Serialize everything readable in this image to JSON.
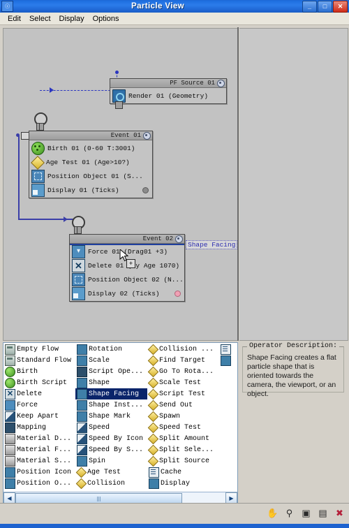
{
  "window": {
    "title": "Particle View",
    "system_icon": "particle-view-icon",
    "buttons": [
      {
        "name": "minimize-button",
        "glyph": "_"
      },
      {
        "name": "maximize-button",
        "glyph": "□"
      },
      {
        "name": "close-button",
        "glyph": "✕"
      }
    ]
  },
  "menubar": {
    "items": [
      {
        "label": "Edit"
      },
      {
        "label": "Select"
      },
      {
        "label": "Display"
      },
      {
        "label": "Options"
      }
    ]
  },
  "graph": {
    "nodes": [
      {
        "title": "PF Source 01",
        "rows": [
          {
            "label": "Render 01 (Geometry)",
            "icon": "render-icon",
            "dot": ""
          }
        ]
      },
      {
        "title": "Event 01",
        "rows": [
          {
            "label": "Birth 01  (0-60 T:3001)",
            "icon": "birth-icon",
            "dot": ""
          },
          {
            "label": "Age Test 01  (Age>10?)",
            "icon": "test-icon",
            "dot": ""
          },
          {
            "label": "Position Object 01  (S...",
            "icon": "position-object-icon",
            "dot": ""
          },
          {
            "label": "Display 01 (Ticks)",
            "icon": "display-icon",
            "dot": "gray"
          }
        ]
      },
      {
        "title": "Event 02",
        "rows": [
          {
            "label": "Force 01 (Drag01 +3)",
            "icon": "force-icon",
            "dot": ""
          },
          {
            "label": "Delete 01 (By Age 1070)",
            "icon": "delete-icon",
            "dot": ""
          },
          {
            "label": "Position Object 02  (N...",
            "icon": "position-object-icon",
            "dot": ""
          },
          {
            "label": "Display 02 (Ticks)",
            "icon": "display-icon",
            "dot": "pink"
          }
        ]
      }
    ],
    "drag_ghost_label": "Shape Facing",
    "cursor_badge": "+"
  },
  "depot": {
    "columns": [
      {
        "items": [
          {
            "label": "Empty Flow",
            "icon": "empty-flow-icon",
            "style": "flow",
            "selected": false
          },
          {
            "label": "Standard Flow",
            "icon": "standard-flow-icon",
            "style": "flow",
            "selected": false
          },
          {
            "label": "Birth",
            "icon": "birth-icon",
            "style": "birth",
            "selected": false
          },
          {
            "label": "Birth Script",
            "icon": "birth-script-icon",
            "style": "birth",
            "selected": false
          },
          {
            "label": "Delete",
            "icon": "delete-icon",
            "style": "del",
            "selected": false
          },
          {
            "label": "Force",
            "icon": "force-icon",
            "style": "blue",
            "selected": false
          },
          {
            "label": "Keep Apart",
            "icon": "keep-apart-icon",
            "style": "speed",
            "selected": false
          },
          {
            "label": "Mapping",
            "icon": "mapping-icon",
            "style": "dark",
            "selected": false
          },
          {
            "label": "Material D...",
            "icon": "material-dynamic-icon",
            "style": "gray",
            "selected": false
          },
          {
            "label": "Material F...",
            "icon": "material-frequency-icon",
            "style": "gray",
            "selected": false
          },
          {
            "label": "Material S...",
            "icon": "material-static-icon",
            "style": "gray",
            "selected": false
          },
          {
            "label": "Position Icon",
            "icon": "position-icon",
            "style": "teal",
            "selected": false
          },
          {
            "label": "Position O...",
            "icon": "position-object-icon",
            "style": "teal",
            "selected": false
          }
        ]
      },
      {
        "items": [
          {
            "label": "Rotation",
            "icon": "rotation-icon",
            "style": "teal",
            "selected": false
          },
          {
            "label": "Scale",
            "icon": "scale-icon",
            "style": "teal",
            "selected": false
          },
          {
            "label": "Script Ope...",
            "icon": "script-operator-icon",
            "style": "dark",
            "selected": false
          },
          {
            "label": "Shape",
            "icon": "shape-icon",
            "style": "teal",
            "selected": false
          },
          {
            "label": "Shape Facing",
            "icon": "shape-facing-icon",
            "style": "teal",
            "selected": true
          },
          {
            "label": "Shape Inst...",
            "icon": "shape-instance-icon",
            "style": "teal",
            "selected": false
          },
          {
            "label": "Shape Mark",
            "icon": "shape-mark-icon",
            "style": "teal",
            "selected": false
          },
          {
            "label": "Speed",
            "icon": "speed-icon",
            "style": "speed",
            "selected": false
          },
          {
            "label": "Speed By Icon",
            "icon": "speed-by-icon-icon",
            "style": "speed",
            "selected": false
          },
          {
            "label": "Speed By S...",
            "icon": "speed-by-surface-icon",
            "style": "speed",
            "selected": false
          },
          {
            "label": "Spin",
            "icon": "spin-icon",
            "style": "teal",
            "selected": false
          },
          {
            "label": "Age Test",
            "icon": "age-test-icon",
            "style": "diam",
            "selected": false
          },
          {
            "label": "Collision",
            "icon": "collision-icon",
            "style": "diam",
            "selected": false
          }
        ]
      },
      {
        "items": [
          {
            "label": "Collision ...",
            "icon": "collision-spawn-icon",
            "style": "diam",
            "selected": false
          },
          {
            "label": "Find Target",
            "icon": "find-target-icon",
            "style": "diam",
            "selected": false
          },
          {
            "label": "Go To Rota...",
            "icon": "go-to-rotation-icon",
            "style": "diam",
            "selected": false
          },
          {
            "label": "Scale Test",
            "icon": "scale-test-icon",
            "style": "diam",
            "selected": false
          },
          {
            "label": "Script Test",
            "icon": "script-test-icon",
            "style": "diam",
            "selected": false
          },
          {
            "label": "Send Out",
            "icon": "send-out-icon",
            "style": "diam",
            "selected": false
          },
          {
            "label": "Spawn",
            "icon": "spawn-icon",
            "style": "diam",
            "selected": false
          },
          {
            "label": "Speed Test",
            "icon": "speed-test-icon",
            "style": "diam",
            "selected": false
          },
          {
            "label": "Split Amount",
            "icon": "split-amount-icon",
            "style": "diam",
            "selected": false
          },
          {
            "label": "Split Sele...",
            "icon": "split-selected-icon",
            "style": "diam",
            "selected": false
          },
          {
            "label": "Split Source",
            "icon": "split-source-icon",
            "style": "diam",
            "selected": false
          },
          {
            "label": "Cache",
            "icon": "cache-icon",
            "style": "doc",
            "selected": false
          },
          {
            "label": "Display",
            "icon": "display-icon",
            "style": "teal",
            "selected": false
          }
        ]
      },
      {
        "items": [
          {
            "label": "",
            "icon": "notes-icon",
            "style": "doc",
            "selected": false
          },
          {
            "label": "",
            "icon": "render-icon",
            "style": "teal",
            "selected": false
          }
        ]
      }
    ],
    "scrollbar": {
      "left_arrow": "◀",
      "right_arrow": "▶"
    }
  },
  "operator_description": {
    "title": "Operator Description:",
    "text": "Shape Facing creates a flat particle shape that is oriented towards the camera, the viewport, or an object."
  },
  "bottom_toolbar": {
    "icons": [
      {
        "name": "pan-hand-icon",
        "glyph": "✋"
      },
      {
        "name": "zoom-magnifier-icon",
        "glyph": "⚲"
      },
      {
        "name": "zoom-region-icon",
        "glyph": "▣"
      },
      {
        "name": "zoom-extents-icon",
        "glyph": "▤"
      },
      {
        "name": "zoom-extents-selected-icon",
        "glyph": "✖"
      }
    ]
  },
  "colors": {
    "title_blue": "#1f6fe0",
    "selection_blue": "#0a246a",
    "wire_blue": "#3b3fa8",
    "canvas_gray": "#c2c2c2"
  }
}
